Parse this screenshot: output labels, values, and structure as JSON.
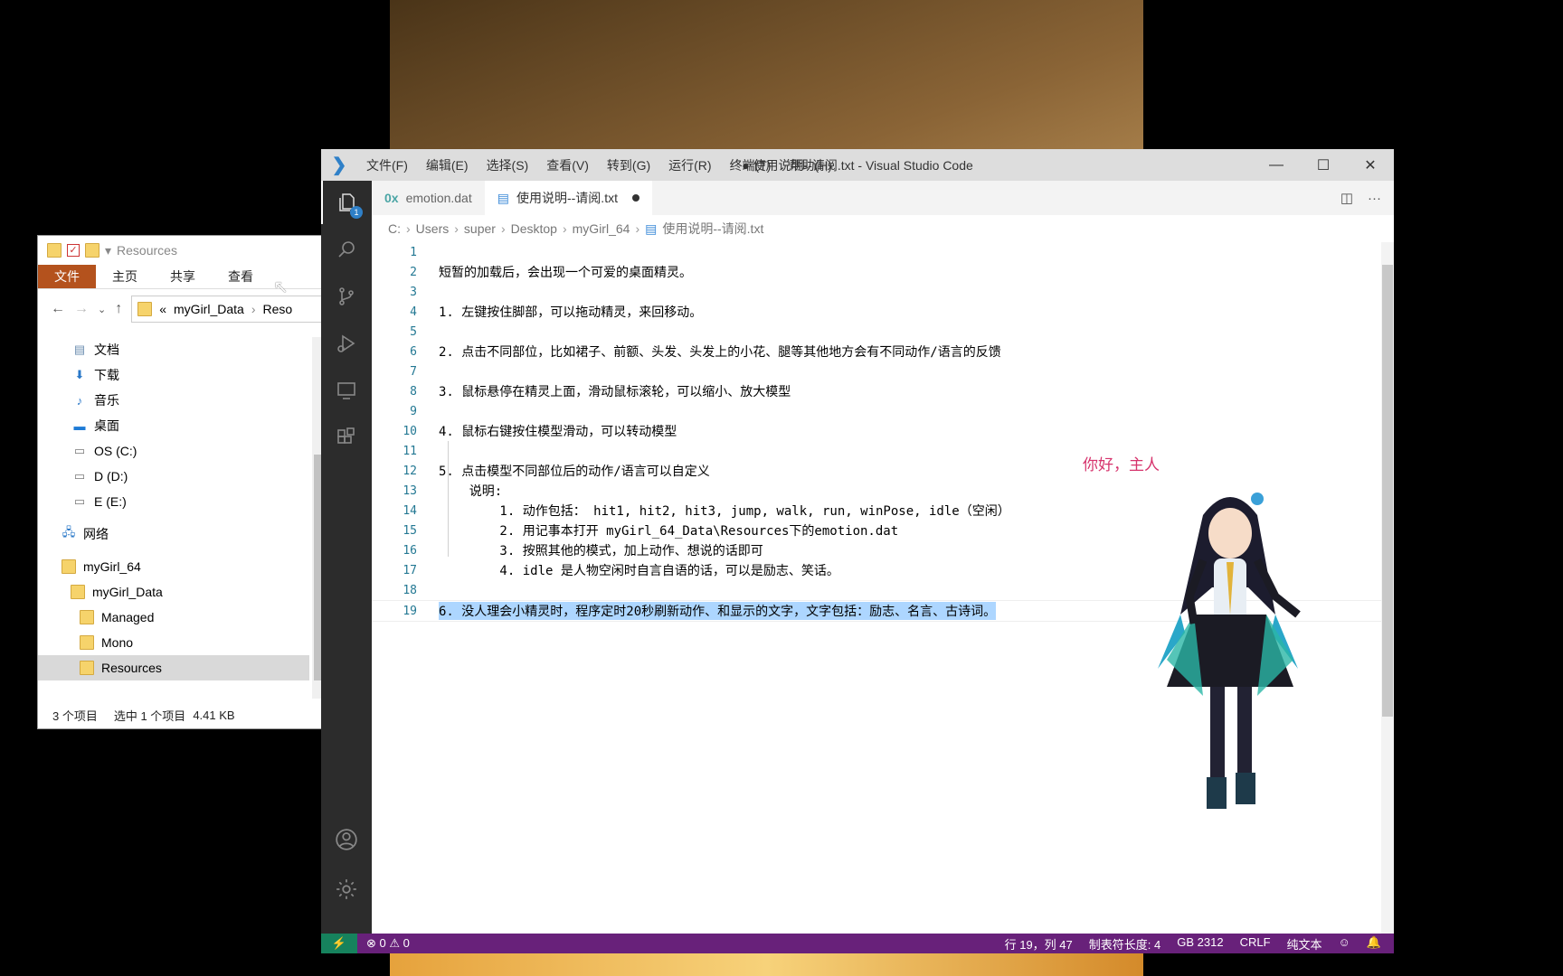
{
  "explorer": {
    "title": "Resources",
    "ribbon": {
      "file": "文件",
      "tabs": [
        "主页",
        "共享",
        "查看"
      ]
    },
    "address": {
      "prefix": "«",
      "part1": "myGirl_Data",
      "part2": "Reso"
    },
    "tree": [
      {
        "label": "文档",
        "icon": "document-icon"
      },
      {
        "label": "下载",
        "icon": "download-icon"
      },
      {
        "label": "音乐",
        "icon": "music-icon"
      },
      {
        "label": "桌面",
        "icon": "desktop-icon"
      },
      {
        "label": "OS (C:)",
        "icon": "drive-icon"
      },
      {
        "label": "D (D:)",
        "icon": "drive-icon"
      },
      {
        "label": "E (E:)",
        "icon": "drive-icon"
      },
      {
        "label": "网络",
        "icon": "network-icon"
      },
      {
        "label": "myGirl_64",
        "icon": "folder-icon"
      },
      {
        "label": "myGirl_Data",
        "icon": "folder-icon"
      },
      {
        "label": "Managed",
        "icon": "folder-icon"
      },
      {
        "label": "Mono",
        "icon": "folder-icon"
      },
      {
        "label": "Resources",
        "icon": "folder-icon"
      }
    ],
    "status": {
      "count": "3 个项目",
      "selected": "选中 1 个项目",
      "size": "4.41 KB"
    }
  },
  "vscode": {
    "menu": [
      "文件(F)",
      "编辑(E)",
      "选择(S)",
      "查看(V)",
      "转到(G)",
      "运行(R)",
      "终端(T)",
      "帮助(H)"
    ],
    "window_title": "● 使用说明--请阅.txt - Visual Studio Code",
    "tabs": [
      {
        "label": "emotion.dat",
        "icon": "0x"
      },
      {
        "label": "使用说明--请阅.txt"
      }
    ],
    "explorer_badge": "1",
    "breadcrumbs": [
      "C:",
      "Users",
      "super",
      "Desktop",
      "myGirl_64",
      "使用说明--请阅.txt"
    ],
    "lines": [
      "",
      "短暂的加载后，会出现一个可爱的桌面精灵。",
      "",
      "1. 左键按住脚部，可以拖动精灵，来回移动。",
      "",
      "2. 点击不同部位，比如裙子、前额、头发、头发上的小花、腿等其他地方会有不同动作/语言的反馈",
      "",
      "3. 鼠标悬停在精灵上面，滑动鼠标滚轮，可以缩小、放大模型",
      "",
      "4. 鼠标右键按住模型滑动，可以转动模型",
      "",
      "5. 点击模型不同部位后的动作/语言可以自定义",
      "    说明:",
      "        1. 动作包括： hit1, hit2, hit3, jump, walk, run, winPose, idle（空闲）",
      "        2. 用记事本打开 myGirl_64_Data\\Resources下的emotion.dat",
      "        3. 按照其他的模式，加上动作、想说的话即可",
      "        4. idle 是人物空闲时自言自语的话，可以是励志、笑话。",
      "",
      "6. 没人理会小精灵时，程序定时20秒刷新动作、和显示的文字，文字包括：励志、名言、古诗词。"
    ],
    "line_numbers": [
      "1",
      "2",
      "3",
      "4",
      "5",
      "6",
      "7",
      "8",
      "9",
      "10",
      "11",
      "12",
      "13",
      "14",
      "15",
      "16",
      "17",
      "18",
      "19"
    ],
    "status": {
      "errors": "0",
      "warnings": "0",
      "position": "行 19，列 47",
      "tab_size": "制表符长度: 4",
      "encoding": "GB 2312",
      "eol": "CRLF",
      "language": "纯文本"
    }
  },
  "mascot": {
    "speech": "你好，主人"
  },
  "colors": {
    "statusbar": "#68217a",
    "remote": "#16825d",
    "explorer_file_tab": "#b4521d"
  }
}
